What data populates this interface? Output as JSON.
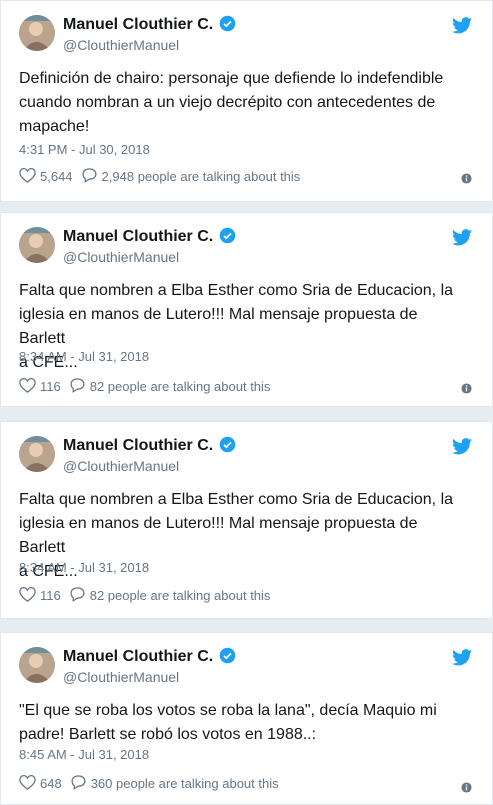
{
  "tweets": [
    {
      "author": "Manuel Clouthier C.",
      "handle": "@ClouthierManuel",
      "text": "Definición de chairo: personaje que defiende lo indefendible\ncuando nombran a un viejo decrépito con antecedentes de\nmapache!",
      "time": "4:31 PM - Jul 30, 2018",
      "likes": "5,644",
      "talking": "2,948 people are talking about this"
    },
    {
      "author": "Manuel Clouthier C.",
      "handle": "@ClouthierManuel",
      "text": "Falta que nombren a Elba Esther como Sria de Educacion, la\niglesia en manos de Lutero!!! Mal mensaje propuesta de Barlett\na CFE...",
      "time": "8:34 AM - Jul 31, 2018",
      "likes": "116",
      "talking": "82 people are talking about this"
    },
    {
      "author": "Manuel Clouthier C.",
      "handle": "@ClouthierManuel",
      "text": "Falta que nombren a Elba Esther como Sria de Educacion, la\niglesia en manos de Lutero!!! Mal mensaje propuesta de Barlett\na CFE...",
      "time": "8:34 AM - Jul 31, 2018",
      "likes": "116",
      "talking": "82 people are talking about this"
    },
    {
      "author": "Manuel Clouthier C.",
      "handle": "@ClouthierManuel",
      "text": "\"El que se roba los votos se roba la lana\", decía Maquio mi\npadre! Barlett se robó los votos en 1988..:",
      "time": "8:45 AM - Jul 31, 2018",
      "likes": "648",
      "talking": "360 people are talking about this"
    }
  ],
  "colors": {
    "verified": "#1da1f2",
    "twitter_bird": "#1da1f2",
    "muted": "#657786"
  },
  "icons": [
    "twitter-bird-icon",
    "verified-badge-icon",
    "heart-icon",
    "reply-bubble-icon",
    "info-icon"
  ]
}
